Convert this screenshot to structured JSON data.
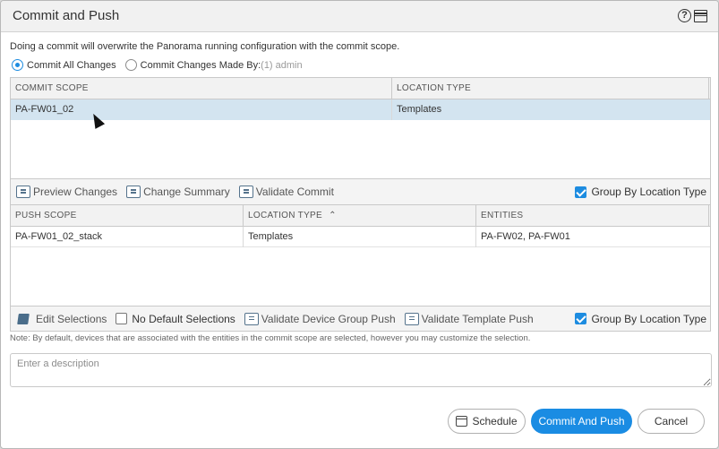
{
  "dialog": {
    "title": "Commit and Push"
  },
  "info_text": "Doing a commit will overwrite the Panorama running configuration with the commit scope.",
  "radios": {
    "all": {
      "label": "Commit All Changes",
      "checked": true
    },
    "made_by": {
      "label": "Commit Changes Made By:",
      "suffix": "(1) admin",
      "checked": false
    }
  },
  "commit_grid": {
    "headers": [
      "COMMIT SCOPE",
      "LOCATION TYPE"
    ],
    "rows": [
      [
        "PA-FW01_02",
        "Templates"
      ]
    ]
  },
  "commit_toolbar": {
    "preview": "Preview Changes",
    "summary": "Change Summary",
    "validate": "Validate Commit",
    "group_by": "Group By Location Type"
  },
  "push_grid": {
    "headers": [
      "PUSH SCOPE",
      "LOCATION TYPE",
      "ENTITIES"
    ],
    "rows": [
      [
        "PA-FW01_02_stack",
        "Templates",
        "PA-FW02, PA-FW01"
      ]
    ]
  },
  "push_toolbar": {
    "edit": "Edit Selections",
    "no_default": "No Default Selections",
    "validate_dg": "Validate Device Group Push",
    "validate_tpl": "Validate Template Push",
    "group_by": "Group By Location Type"
  },
  "note": "Note: By default, devices that are associated with the entities in the commit scope are selected, however you may customize the selection.",
  "description": {
    "placeholder": "Enter a description",
    "value": ""
  },
  "buttons": {
    "schedule": "Schedule",
    "commit_push": "Commit And Push",
    "cancel": "Cancel"
  },
  "colors": {
    "accent": "#1a8ce3",
    "selected_row": "#d3e4f0"
  },
  "icons": [
    "help-icon",
    "maximize-icon",
    "preview-changes-icon",
    "change-summary-icon",
    "validate-commit-icon",
    "edit-icon",
    "validate-device-group-icon",
    "validate-template-icon",
    "calendar-icon"
  ]
}
